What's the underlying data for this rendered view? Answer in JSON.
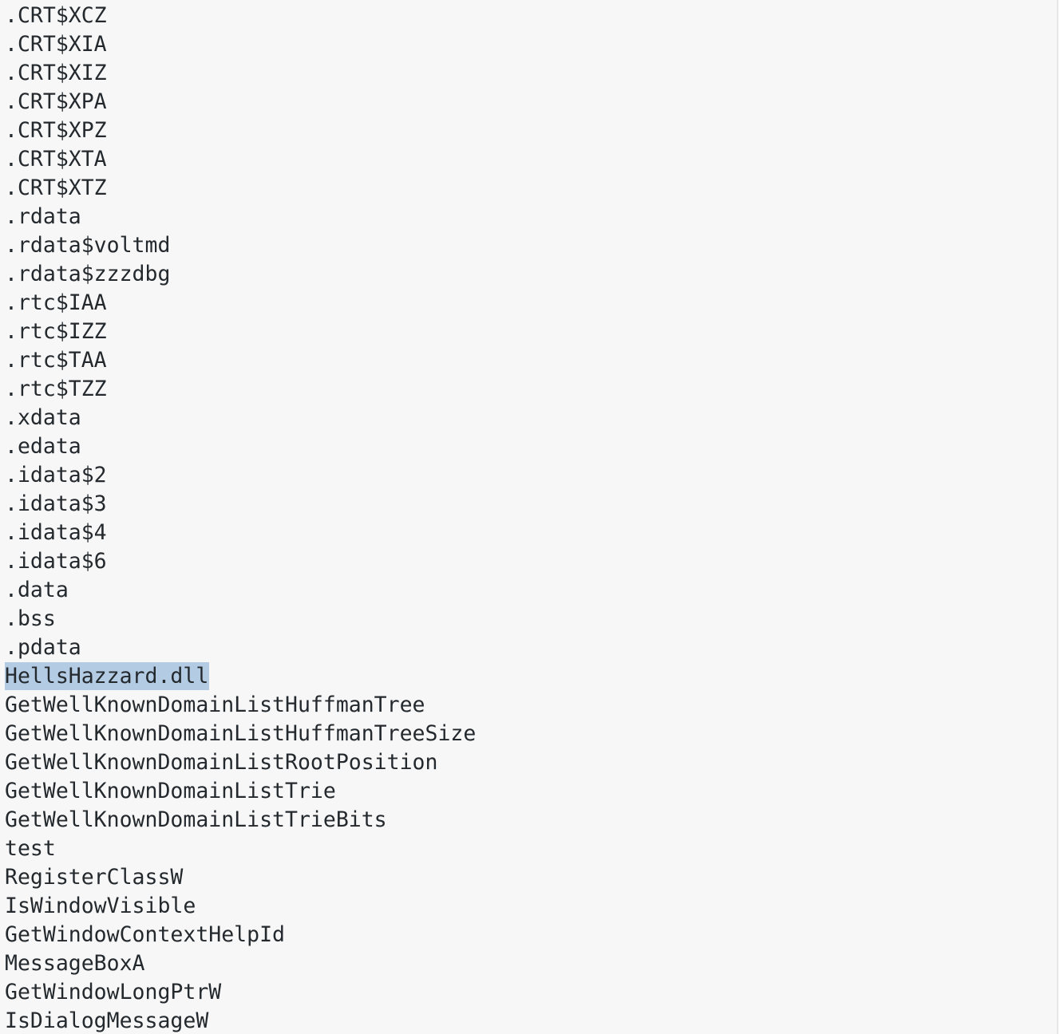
{
  "lines": [
    ".CRT$XCZ",
    ".CRT$XIA",
    ".CRT$XIZ",
    ".CRT$XPA",
    ".CRT$XPZ",
    ".CRT$XTA",
    ".CRT$XTZ",
    ".rdata",
    ".rdata$voltmd",
    ".rdata$zzzdbg",
    ".rtc$IAA",
    ".rtc$IZZ",
    ".rtc$TAA",
    ".rtc$TZZ",
    ".xdata",
    ".edata",
    ".idata$2",
    ".idata$3",
    ".idata$4",
    ".idata$6",
    ".data",
    ".bss",
    ".pdata",
    "HellsHazzard.dll",
    "GetWellKnownDomainListHuffmanTree",
    "GetWellKnownDomainListHuffmanTreeSize",
    "GetWellKnownDomainListRootPosition",
    "GetWellKnownDomainListTrie",
    "GetWellKnownDomainListTrieBits",
    "test",
    "RegisterClassW",
    "IsWindowVisible",
    "GetWindowContextHelpId",
    "MessageBoxA",
    "GetWindowLongPtrW",
    "IsDialogMessageW"
  ],
  "selected_line": "HellsHazzard.dll",
  "colors": {
    "background": "#f7f7f7",
    "text": "#24292e",
    "selection": "#b4cbe4"
  }
}
